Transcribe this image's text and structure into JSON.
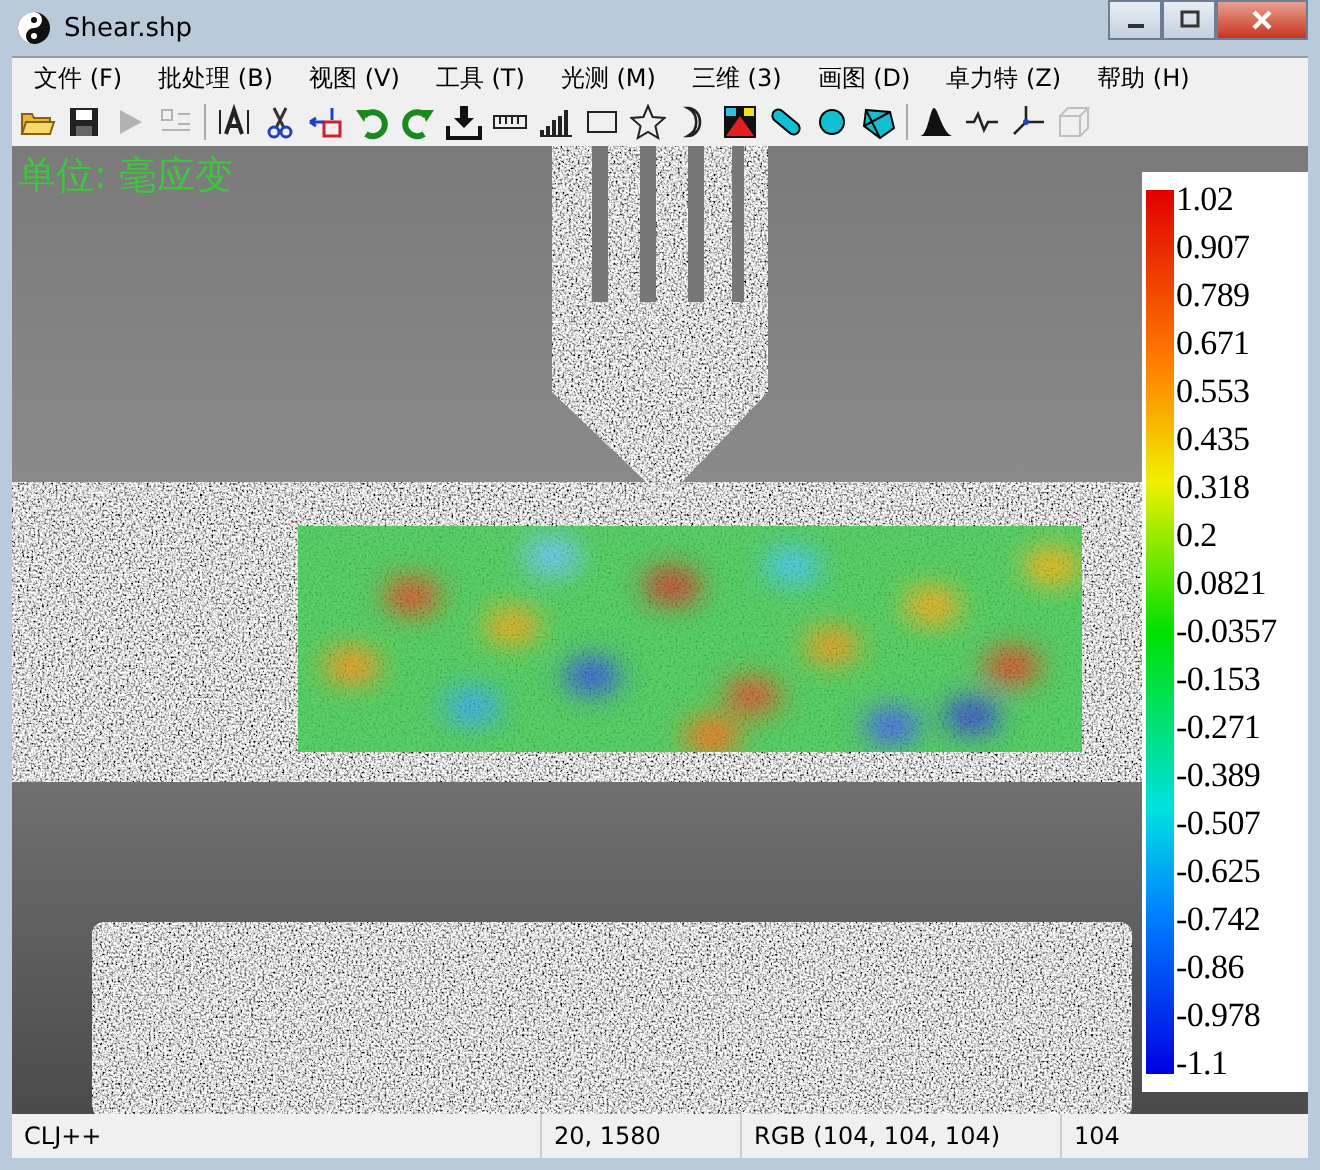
{
  "window": {
    "title": "Shear.shp"
  },
  "menu": [
    {
      "label": "文件 (F)"
    },
    {
      "label": "批处理 (B)"
    },
    {
      "label": "视图 (V)"
    },
    {
      "label": "工具 (T)"
    },
    {
      "label": "光测 (M)"
    },
    {
      "label": "三维 (3)"
    },
    {
      "label": "画图 (D)"
    },
    {
      "label": "卓力特 (Z)"
    },
    {
      "label": "帮助 (H)"
    }
  ],
  "toolbar": [
    {
      "kind": "open",
      "disabled": false
    },
    {
      "kind": "save",
      "disabled": false
    },
    {
      "kind": "play",
      "disabled": true
    },
    {
      "kind": "layout",
      "disabled": true
    },
    {
      "kind": "sep"
    },
    {
      "kind": "text",
      "disabled": false
    },
    {
      "kind": "scissors",
      "disabled": false
    },
    {
      "kind": "move",
      "disabled": false
    },
    {
      "kind": "undo",
      "disabled": false
    },
    {
      "kind": "redo",
      "disabled": false
    },
    {
      "kind": "download",
      "disabled": false
    },
    {
      "kind": "ruler",
      "disabled": false
    },
    {
      "kind": "bars",
      "disabled": false
    },
    {
      "kind": "rect",
      "disabled": false
    },
    {
      "kind": "star",
      "disabled": false
    },
    {
      "kind": "crescent",
      "disabled": false
    },
    {
      "kind": "colormap",
      "disabled": false
    },
    {
      "kind": "pill",
      "disabled": false
    },
    {
      "kind": "circle",
      "disabled": false
    },
    {
      "kind": "polygon",
      "disabled": false
    },
    {
      "kind": "sep"
    },
    {
      "kind": "peak",
      "disabled": false
    },
    {
      "kind": "wave",
      "disabled": false
    },
    {
      "kind": "axes",
      "disabled": false
    },
    {
      "kind": "cube",
      "disabled": true
    }
  ],
  "unit_label": "单位: 毫应变",
  "legend": {
    "labels": [
      "1.02",
      "0.907",
      "0.789",
      "0.671",
      "0.553",
      "0.435",
      "0.318",
      "0.2",
      "0.0821",
      "-0.0357",
      "-0.153",
      "-0.271",
      "-0.389",
      "-0.507",
      "-0.625",
      "-0.742",
      "-0.86",
      "-0.978",
      "-1.1"
    ]
  },
  "status_bar": [
    "CLJ++",
    "20, 1580",
    "RGB (104, 104, 104)",
    "104"
  ]
}
